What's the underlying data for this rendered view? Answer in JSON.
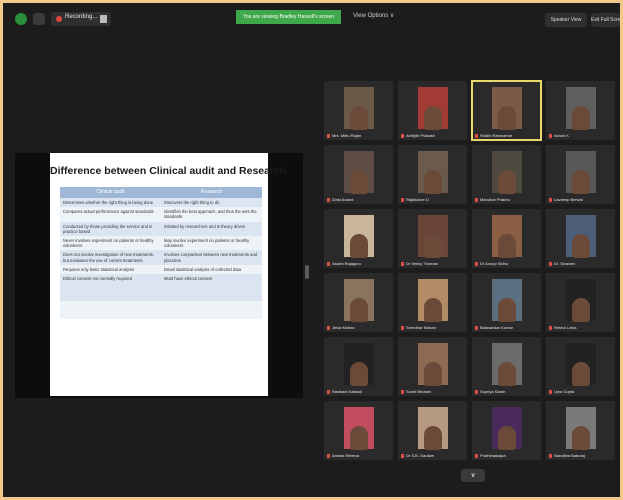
{
  "topbar": {
    "recording_label": "Recording...",
    "share_banner": "You are viewing Bradley Hassell's screen",
    "view_options": "View Options ∨",
    "speaker_view": "Speaker View",
    "exit_full": "Exit Full Screen"
  },
  "slide": {
    "title": "Difference between Clinical audit and Research",
    "columns": [
      "Clinical audit",
      "Research"
    ],
    "rows": [
      [
        "Determines whether the right thing is being done",
        "Discovers the right thing to do"
      ],
      [
        "Compares actual performance against standards",
        "Identifies the best approach, and thus the sets the standards"
      ],
      [
        "Conducted by those providing the service and in practice based",
        "Initiated by researchers and is theory driven"
      ],
      [
        "Never involves experiment on patients or healthy volunteers",
        "May involve experiment on patients or healthy volunteers"
      ],
      [
        "Does not involve investigation of new treatments, but evaluates the use of current treatments",
        "Involves comparison between new treatments and placebos"
      ],
      [
        "Requires only basic statistical analysis",
        "Detail statistical analysis of collected data"
      ],
      [
        "Ethical consent not normally required",
        "Must have ethical consent"
      ]
    ]
  },
  "participants": [
    {
      "name": "Mrs. Mittu Rajan",
      "color": "#6b5846"
    },
    {
      "name": "Abhijith Prakash",
      "color": "#a33b35"
    },
    {
      "name": "Riddhi Ramnarine",
      "color": "#7b5a48"
    },
    {
      "name": "Ashok K",
      "color": "#5f5f5f"
    },
    {
      "name": "Dinki Anand",
      "color": "#5d4c44"
    },
    {
      "name": "Rajkishore D",
      "color": "#6b5a4e"
    },
    {
      "name": "Manohar Prabhu",
      "color": "#4e4a3f"
    },
    {
      "name": "Lavdeep Berwal",
      "color": "#585858"
    },
    {
      "name": "Aswini Rajaguru",
      "color": "#c9b69a"
    },
    {
      "name": "Dr Venky Thomas",
      "color": "#6a4538"
    },
    {
      "name": "Dr Anoop Sidhu",
      "color": "#8b5f44"
    },
    {
      "name": "Dr. Sivaram",
      "color": "#4c5e78"
    },
    {
      "name": "Jelsa Mohan",
      "color": "#8a7460"
    },
    {
      "name": "Sreedhar Mohan",
      "color": "#b28c66"
    },
    {
      "name": "Balasankar Kumar",
      "color": "#5a7080"
    },
    {
      "name": "Rekha Lohia",
      "color": "#222222"
    },
    {
      "name": "Ravikant Kaikadi",
      "color": "#222222"
    },
    {
      "name": "Sumit Bhutani",
      "color": "#8d6b52"
    },
    {
      "name": "Supriya Sarah",
      "color": "#6b6b6b"
    },
    {
      "name": "Ujna Gupta",
      "color": "#222222"
    },
    {
      "name": "Anisha Rebeca",
      "color": "#c24d5f"
    },
    {
      "name": "Dr S.B. Gautam",
      "color": "#b59a82"
    },
    {
      "name": "Prathimakalpa",
      "color": "#4a2a5a"
    },
    {
      "name": "Nanditha Baburaj",
      "color": "#7a7a7a"
    }
  ],
  "more_label": "∨",
  "colors": {
    "share_banner": "#3ea84a",
    "active_speaker": "#e6d86b",
    "frame_border": "#f2c98a"
  }
}
